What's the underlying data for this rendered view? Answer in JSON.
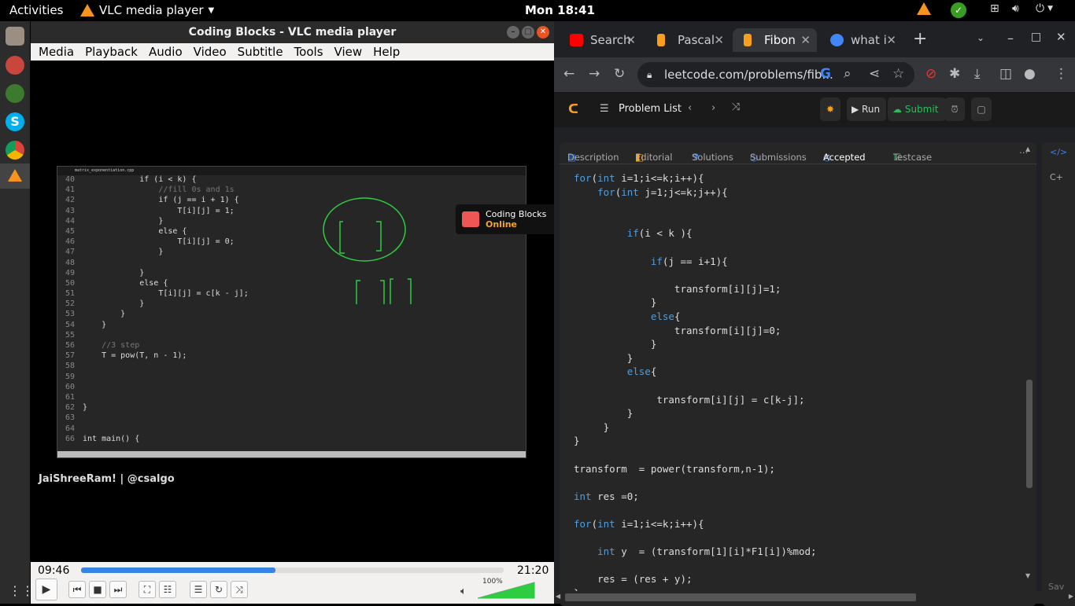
{
  "topbar": {
    "activities": "Activities",
    "app_name": "VLC media player",
    "clock": "Mon 18:41"
  },
  "vlc": {
    "title": "Coding Blocks - VLC media player",
    "menu": [
      "Media",
      "Playback",
      "Audio",
      "Video",
      "Subtitle",
      "Tools",
      "View",
      "Help"
    ],
    "elapsed": "09:46",
    "total": "21:20",
    "progress_fraction": 0.46,
    "volume": "100%",
    "badge_line1": "Coding Blocks",
    "badge_line2": "Online",
    "watermark": "JaiShreeRam! | @csalgo",
    "editor_tab": "matrix_exponentiation.cpp",
    "editor_lines": [
      {
        "n": "40",
        "t": "            if (i < k) {"
      },
      {
        "n": "41",
        "t": "                //fill 0s and 1s"
      },
      {
        "n": "42",
        "t": "                if (j == i + 1) {"
      },
      {
        "n": "43",
        "t": "                    T[i][j] = 1;"
      },
      {
        "n": "44",
        "t": "                }"
      },
      {
        "n": "45",
        "t": "                else {"
      },
      {
        "n": "46",
        "t": "                    T[i][j] = 0;"
      },
      {
        "n": "47",
        "t": "                }"
      },
      {
        "n": "48",
        "t": ""
      },
      {
        "n": "49",
        "t": "            }"
      },
      {
        "n": "50",
        "t": "            else {"
      },
      {
        "n": "51",
        "t": "                T[i][j] = c[k - j];"
      },
      {
        "n": "52",
        "t": "            }"
      },
      {
        "n": "53",
        "t": "        }"
      },
      {
        "n": "54",
        "t": "    }"
      },
      {
        "n": "55",
        "t": ""
      },
      {
        "n": "56",
        "t": "    //3 step"
      },
      {
        "n": "57",
        "t": "    T = pow(T, n - 1);"
      },
      {
        "n": "58",
        "t": ""
      },
      {
        "n": "59",
        "t": ""
      },
      {
        "n": "60",
        "t": ""
      },
      {
        "n": "61",
        "t": ""
      },
      {
        "n": "62",
        "t": "}"
      },
      {
        "n": "63",
        "t": ""
      },
      {
        "n": "64",
        "t": ""
      },
      {
        "n": "66",
        "t": "int main() {"
      }
    ]
  },
  "browser": {
    "tabs": [
      {
        "label": "Search",
        "color": "#ff0000"
      },
      {
        "label": "Pascal",
        "color": "#f89f1b"
      },
      {
        "label": "Fibon",
        "color": "#f89f1b"
      },
      {
        "label": "what i",
        "color": "#4285f4"
      }
    ],
    "url": "leetcode.com/problems/fib...",
    "lc": {
      "problem_list": "Problem List",
      "run": "Run",
      "submit": "Submit"
    },
    "panel_tabs": [
      "Description",
      "Editorial",
      "Solutions",
      "Submissions",
      "Accepted",
      "Testcase"
    ],
    "side_label": "C+",
    "side_bottom": "Sav",
    "code_lines": [
      "for(int i=1;i<=k;i++){",
      "    for(int j=1;j<=k;j++){",
      "",
      "",
      "         if(i < k ){",
      "",
      "             if(j == i+1){",
      "",
      "                 transform[i][j]=1;",
      "             }",
      "             else{",
      "                 transform[i][j]=0;",
      "             }",
      "         }",
      "         else{",
      "",
      "              transform[i][j] = c[k-j];",
      "         }",
      "     }",
      "}",
      "",
      "transform  = power(transform,n-1);",
      "",
      "int res =0;",
      "",
      "for(int i=1;i<=k;i++){",
      "",
      "    int y  = (transform[1][i]*F1[i])%mod;",
      "",
      "    res = (res + y);",
      "}"
    ]
  }
}
